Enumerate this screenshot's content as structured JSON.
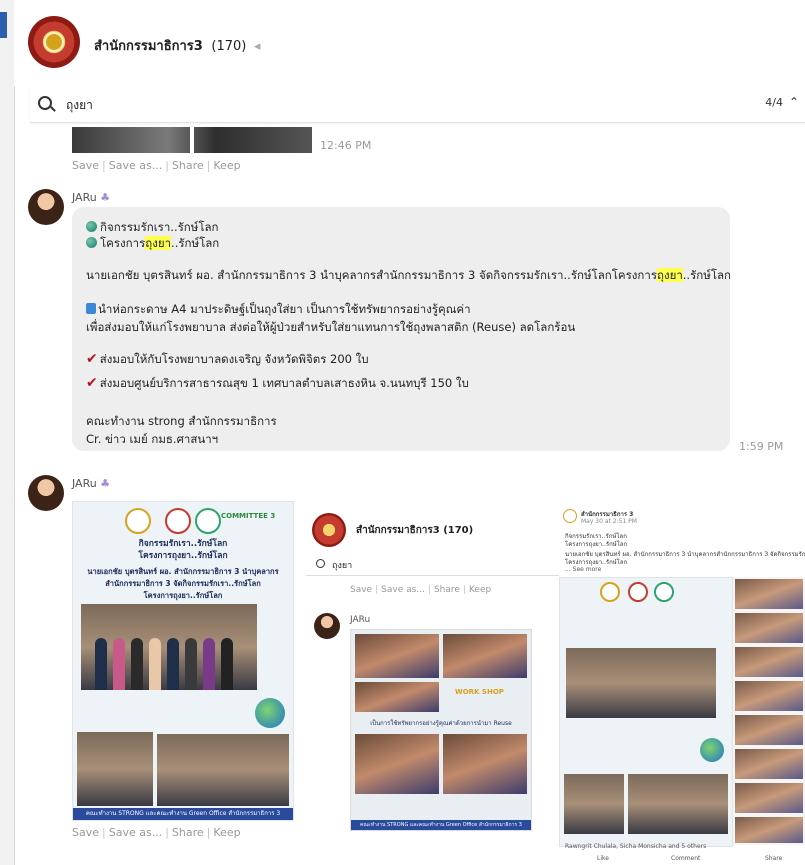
{
  "chat": {
    "title": "สำนักกรรมาธิการ3",
    "member_count": "(170)"
  },
  "search": {
    "query": "ถุงยา",
    "result_counter": "4/4"
  },
  "messages": [
    {
      "time": "12:46 PM",
      "actions": [
        "Save",
        "Save as...",
        "Share",
        "Keep"
      ]
    },
    {
      "sender": "JARu",
      "time": "1:59 PM",
      "lines": [
        "กิจกรรมรักเรา..รักษ์โลก",
        "โครงการ",
        "ถุงยา",
        "..รักษ์โลก",
        "นายเอกชัย บุตรสินทร์ ผอ. สำนักกรรมาธิการ 3 นำบุคลากรสำนักกรรมาธิการ 3 จัดกิจกรรมรักเรา..รักษ์โลกโครงการ",
        "ถุงยา",
        "..รักษ์โลก",
        "นำห่อกระดาษ A4 มาประดิษฐ์เป็นถุงใส่ยา เป็นการใช้ทรัพยากรอย่างรู้คุณค่า",
        "เพื่อส่งมอบให้แก่โรงพยาบาล ส่งต่อให้ผู้ป่วยสำหรับใส่ยาแทนการใช้ถุงพลาสติก (Reuse) ลดโลกร้อน",
        "ส่งมอบให้กับโรงพยาบาลดงเจริญ จังหวัดพิจิตร 200 ใบ",
        "ส่งมอบศูนย์บริการสาธารณสุข 1 เทศบาลตำบลเสาธงหิน จ.นนทบุรี 150 ใบ",
        "คณะทำงาน strong สำนักกรรมาธิการ",
        "Cr. ข่าว เมย์ กมธ.ศาสนาฯ"
      ]
    },
    {
      "sender": "JARu",
      "actions": [
        "Save",
        "Save as...",
        "Share",
        "Keep"
      ]
    }
  ],
  "poster": {
    "headline1": "กิจกรรมรักเรา..รักษ์โลก",
    "headline2": "โครงการถุงยา..รักษ์โลก",
    "body1": "นายเอกชัย บุตรสินทร์ ผอ. สำนักกรรมาธิการ 3 นำบุคลากร",
    "body2": "สำนักกรรมาธิการ 3 จัดกิจกรรมรักเรา..รักษ์โลก",
    "body3": "โครงการถุงยา..รักษ์โลก",
    "brand": "COMMITTEE 3",
    "footer": "คณะทำงาน STRONG และคณะทำงาน Green Office สำนักกรรมาธิการ 3"
  },
  "inner_screenshot": {
    "title": "สำนักกรรมาธิการ3 (170)",
    "query": "ถุงยา",
    "sender": "JARu",
    "actions": [
      "Save",
      "Save as...",
      "Share",
      "Keep"
    ],
    "workshop": "WORK SHOP",
    "caption": "เป็นการใช้ทรัพยากรอย่างรู้คุณค่าด้วยการนำมา Reuse",
    "footer": "คณะทำงาน STRONG และคณะทำงาน Green Office สำนักกรรมาธิการ 3"
  },
  "fb_post": {
    "page": "สำนักกรรมาธิการ 3",
    "date": "May 30 at 2:51 PM",
    "line1": "กิจกรรมรักเรา..รักษ์โลก",
    "line2": "โครงการถุงยา..รักษ์โลก",
    "line3": "นายเอกชัย บุตรสินทร์ ผอ. สำนักกรรมาธิการ 3 นำบุคลากรสำนักกรรมาธิการ 3 จัดกิจกรรมรักเรา..รักษ์โลก",
    "line4": "โครงการถุงยา..รักษ์โลก",
    "see_more": "... See more",
    "reactions": "Rawngrit Chulala, Sicha Monsicha and 5 others",
    "like": "Like",
    "comment": "Comment",
    "share": "Share"
  }
}
